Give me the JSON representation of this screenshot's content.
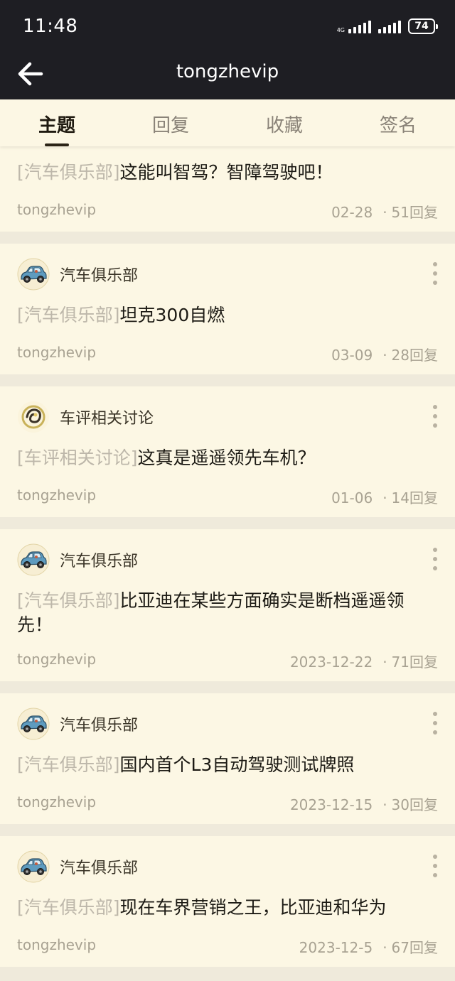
{
  "status_bar": {
    "time": "11:48",
    "battery": "74"
  },
  "header": {
    "title": "tongzhevip"
  },
  "tabs": [
    {
      "label": "主题",
      "active": true
    },
    {
      "label": "回复",
      "active": false
    },
    {
      "label": "收藏",
      "active": false
    },
    {
      "label": "签名",
      "active": false
    }
  ],
  "posts": [
    {
      "forum": "",
      "tag": "[汽车俱乐部]",
      "title": "这能叫智驾？智障驾驶吧！",
      "author": "tongzhevip",
      "date": "02-28",
      "replies": "51回复"
    },
    {
      "forum": "汽车俱乐部",
      "avatar_icon": "car-icon",
      "tag": "[汽车俱乐部]",
      "title": "坦克300自燃",
      "author": "tongzhevip",
      "date": "03-09",
      "replies": "28回复"
    },
    {
      "forum": "车评相关讨论",
      "avatar_icon": "swirl-logo-icon",
      "tag": "[车评相关讨论]",
      "title": "这真是遥遥领先车机？",
      "author": "tongzhevip",
      "date": "01-06",
      "replies": "14回复"
    },
    {
      "forum": "汽车俱乐部",
      "avatar_icon": "car-icon",
      "tag": "[汽车俱乐部]",
      "title": "比亚迪在某些方面确实是断档遥遥领先！",
      "author": "tongzhevip",
      "date": "2023-12-22",
      "replies": "71回复"
    },
    {
      "forum": "汽车俱乐部",
      "avatar_icon": "car-icon",
      "tag": "[汽车俱乐部]",
      "title": "国内首个L3自动驾驶测试牌照",
      "author": "tongzhevip",
      "date": "2023-12-15",
      "replies": "30回复"
    },
    {
      "forum": "汽车俱乐部",
      "avatar_icon": "car-icon",
      "tag": "[汽车俱乐部]",
      "title": "现在车界营销之王，比亚迪和华为",
      "author": "tongzhevip",
      "date": "2023-12-5",
      "replies": "67回复"
    }
  ],
  "separator": " · "
}
